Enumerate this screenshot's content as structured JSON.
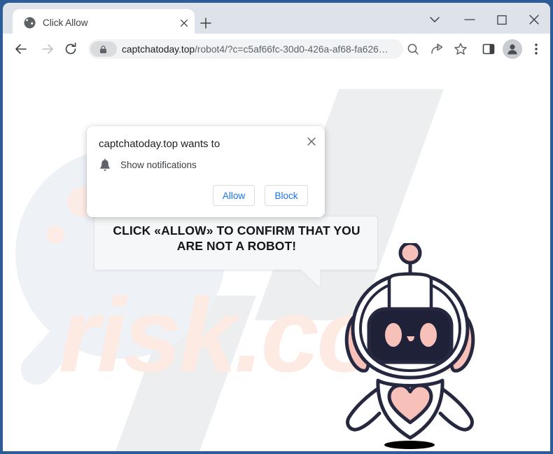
{
  "window": {
    "frame_color": "#2e5c96",
    "titlebar_color": "#dee3ea",
    "controls": {
      "tab_search_label": "tab-search",
      "minimize_label": "minimize",
      "maximize_label": "maximize",
      "close_label": "close"
    }
  },
  "tab": {
    "title": "Click Allow",
    "favicon": "globe-icon",
    "close_label": "close-tab",
    "new_tab_label": "new-tab"
  },
  "toolbar": {
    "back_label": "back",
    "forward_label": "forward",
    "reload_label": "reload",
    "search_icon": "search-icon",
    "share_icon": "share-icon",
    "bookmark_icon": "star-icon",
    "side_panel_icon": "side-panel-icon",
    "profile_icon": "avatar-icon",
    "menu_icon": "three-dot-menu-icon"
  },
  "omnibox": {
    "lock_icon": "lock-icon",
    "url_domain": "captchatoday.top",
    "url_path": "/robot4/?c=c5af66fc-30d0-426a-af68-fa626…",
    "full_url": "captchatoday.top/robot4/?c=c5af66fc-30d0-426a-af68-fa626…"
  },
  "popup": {
    "title": "captchatoday.top wants to",
    "permission": "Show notifications",
    "permission_icon": "bell-icon",
    "close_label": "close-popup",
    "allow_label": "Allow",
    "block_label": "Block",
    "accent_color": "#1a73e8"
  },
  "page": {
    "bubble_text": "CLICK «ALLOW» TO CONFIRM THAT YOU ARE NOT A ROBOT!",
    "watermark_text": "risk.com",
    "robot_outline_color": "#262840",
    "robot_accent_color": "#f7c0b8",
    "robot_screen_color": "#1f2139"
  }
}
